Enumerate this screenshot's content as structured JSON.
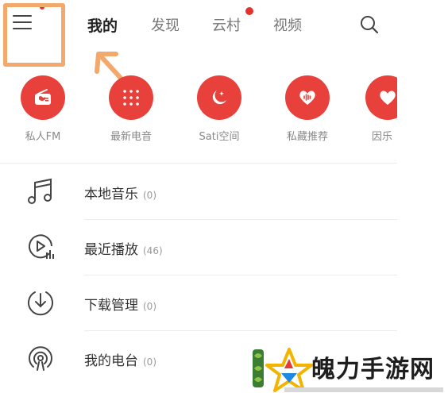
{
  "header": {
    "tabs": [
      {
        "label": "我的",
        "active": true
      },
      {
        "label": "发现",
        "active": false
      },
      {
        "label": "云村",
        "active": false,
        "badge": true
      },
      {
        "label": "视频",
        "active": false
      }
    ],
    "menu_icon": "menu-icon",
    "search_icon": "search-icon"
  },
  "quick_actions": [
    {
      "label": "私人FM",
      "icon": "radio-icon"
    },
    {
      "label": "最新电音",
      "icon": "dots-grid-icon"
    },
    {
      "label": "Sati空间",
      "icon": "moon-icon"
    },
    {
      "label": "私藏推荐",
      "icon": "heart-wave-icon"
    },
    {
      "label": "因乐",
      "icon": "heart-icon"
    }
  ],
  "list": [
    {
      "label": "本地音乐",
      "count": "(0)",
      "icon": "music-note-icon"
    },
    {
      "label": "最近播放",
      "count": "(46)",
      "icon": "play-recent-icon"
    },
    {
      "label": "下载管理",
      "count": "(0)",
      "icon": "download-icon"
    },
    {
      "label": "我的电台",
      "count": "(0)",
      "icon": "podcast-icon"
    }
  ],
  "watermark": {
    "title": "魄力手游网"
  },
  "colors": {
    "accent": "#e8413b",
    "highlight": "#f3a86c",
    "badge": "#e2342f"
  }
}
